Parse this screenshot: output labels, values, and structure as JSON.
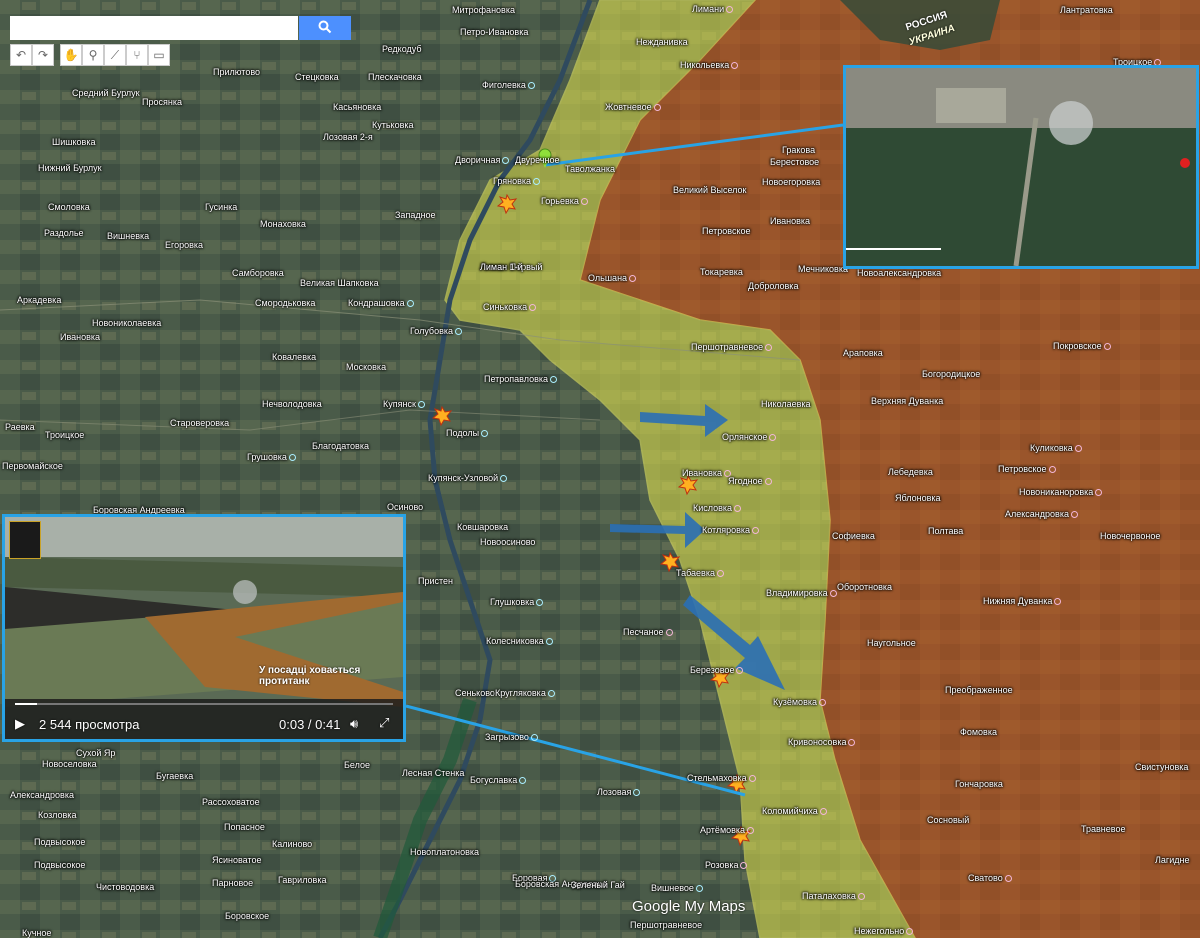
{
  "search": {
    "placeholder": "",
    "value": ""
  },
  "toolbar": {
    "undo_icon": "undo-icon",
    "redo_icon": "redo-icon",
    "pan_icon": "hand-icon",
    "marker_icon": "marker-icon",
    "line_icon": "line-icon",
    "route_icon": "route-icon",
    "ruler_icon": "ruler-icon"
  },
  "border_labels": {
    "russia": "РОССИЯ",
    "ukraine": "УКРАИНА"
  },
  "video_left": {
    "caption": "У посадці ховається протитанк",
    "views": "2 544 просмотра",
    "time": "0:03 / 0:41"
  },
  "watermark": "Google My Maps",
  "colors": {
    "ukraine_zone": "#e6e64d",
    "russia_zone": "#c4622a",
    "accent": "#29a3e6",
    "arrow": "#2a6fb5"
  },
  "places": [
    {
      "name": "Митрофановка",
      "dot": "none"
    },
    {
      "name": "Петро-Ивановка",
      "dot": "none"
    },
    {
      "name": "Редкодуб",
      "dot": "none"
    },
    {
      "name": "Прилютово",
      "dot": "none"
    },
    {
      "name": "Стецковка",
      "dot": "none"
    },
    {
      "name": "Плескачовка",
      "dot": "none"
    },
    {
      "name": "Фиголевка",
      "dot": "blue"
    },
    {
      "name": "Средний Бурлук",
      "dot": "none"
    },
    {
      "name": "Просянка",
      "dot": "none"
    },
    {
      "name": "Касьяновка",
      "dot": "none"
    },
    {
      "name": "Кутьковка",
      "dot": "none"
    },
    {
      "name": "Лозовая 2-я",
      "dot": "none"
    },
    {
      "name": "Шишковка",
      "dot": "none"
    },
    {
      "name": "Нижний Бурлук",
      "dot": "none"
    },
    {
      "name": "Дворичная",
      "dot": "blue"
    },
    {
      "name": "Двуречное",
      "dot": "none"
    },
    {
      "name": "Гряновка",
      "dot": "blue"
    },
    {
      "name": "Таволжанка",
      "dot": "none"
    },
    {
      "name": "Смоловка",
      "dot": "none"
    },
    {
      "name": "Гусинка",
      "dot": "none"
    },
    {
      "name": "Западное",
      "dot": "none"
    },
    {
      "name": "Раздолье",
      "dot": "none"
    },
    {
      "name": "Вишневка",
      "dot": "none"
    },
    {
      "name": "Монаховка",
      "dot": "none"
    },
    {
      "name": "Егоровка",
      "dot": "none"
    },
    {
      "name": "Самборовка",
      "dot": "none"
    },
    {
      "name": "Великая Шапковка",
      "dot": "none"
    },
    {
      "name": "Аркадевка",
      "dot": "none"
    },
    {
      "name": "Смородьковка",
      "dot": "none"
    },
    {
      "name": "Кондрашовка",
      "dot": "blue"
    },
    {
      "name": "Новониколаевка",
      "dot": "none"
    },
    {
      "name": "Ивановка",
      "dot": "none"
    },
    {
      "name": "Голубовка",
      "dot": "blue"
    },
    {
      "name": "Ковалевка",
      "dot": "none"
    },
    {
      "name": "Московка",
      "dot": "none"
    },
    {
      "name": "Нечволодовка",
      "dot": "none"
    },
    {
      "name": "Петропавловка",
      "dot": "blue"
    },
    {
      "name": "Купянск",
      "dot": "blue"
    },
    {
      "name": "Раевка",
      "dot": "none"
    },
    {
      "name": "Староверовка",
      "dot": "none"
    },
    {
      "name": "Троицкое",
      "dot": "none"
    },
    {
      "name": "Подолы",
      "dot": "blue"
    },
    {
      "name": "Благодатовка",
      "dot": "none"
    },
    {
      "name": "Грушовка",
      "dot": "blue"
    },
    {
      "name": "Первомайское",
      "dot": "none"
    },
    {
      "name": "Купянск-Узловой",
      "dot": "blue"
    },
    {
      "name": "Боровская Андреевка",
      "dot": "none"
    },
    {
      "name": "Осиново",
      "dot": "none"
    },
    {
      "name": "Ковшаровка",
      "dot": "none"
    },
    {
      "name": "Новоосиново",
      "dot": "none"
    },
    {
      "name": "Пристен",
      "dot": "none"
    },
    {
      "name": "Глушковка",
      "dot": "blue"
    },
    {
      "name": "Колесниковка",
      "dot": "blue"
    },
    {
      "name": "Сеньково",
      "dot": "none"
    },
    {
      "name": "Кругляковка",
      "dot": "blue"
    },
    {
      "name": "Загрызово",
      "dot": "blue"
    },
    {
      "name": "Сухой Яр",
      "dot": "none"
    },
    {
      "name": "Новоселовка",
      "dot": "none"
    },
    {
      "name": "Бугаевка",
      "dot": "none"
    },
    {
      "name": "Белое",
      "dot": "none"
    },
    {
      "name": "Лесная Стенка",
      "dot": "none"
    },
    {
      "name": "Богуславка",
      "dot": "blue"
    },
    {
      "name": "Александровка",
      "dot": "none"
    },
    {
      "name": "Рассоховатое",
      "dot": "none"
    },
    {
      "name": "Козловка",
      "dot": "none"
    },
    {
      "name": "Попасное",
      "dot": "none"
    },
    {
      "name": "Подвысокое",
      "dot": "none"
    },
    {
      "name": "Калиново",
      "dot": "none"
    },
    {
      "name": "Ясиноватое",
      "dot": "none"
    },
    {
      "name": "Новоплатоновка",
      "dot": "none"
    },
    {
      "name": "Подвысокое",
      "dot": "none"
    },
    {
      "name": "Парновое",
      "dot": "none"
    },
    {
      "name": "Гавриловка",
      "dot": "none"
    },
    {
      "name": "Чистоводовка",
      "dot": "none"
    },
    {
      "name": "Боровское",
      "dot": "none"
    },
    {
      "name": "Кучное",
      "dot": "none"
    },
    {
      "name": "Боровая",
      "dot": "blue"
    },
    {
      "name": "Лозовая",
      "dot": "blue"
    },
    {
      "name": "Боровская Андреевка",
      "dot": "none"
    },
    {
      "name": "Зеленый Гай",
      "dot": "none"
    },
    {
      "name": "Вишневое",
      "dot": "blue"
    },
    {
      "name": "Першотравневое",
      "dot": "none"
    },
    {
      "name": "Лиман Первый",
      "dot": "none"
    },
    {
      "name": "Нежданивка",
      "dot": "none"
    },
    {
      "name": "Никольевка",
      "dot": "pink"
    },
    {
      "name": "Жовтневое",
      "dot": "pink"
    },
    {
      "name": "Горьевка",
      "dot": "pink"
    },
    {
      "name": "Лиман 1-й",
      "dot": "none"
    },
    {
      "name": "Синьковка",
      "dot": "pink"
    },
    {
      "name": "Ольшана",
      "dot": "pink"
    },
    {
      "name": "Першотравневое",
      "dot": "pink"
    },
    {
      "name": "Николаевка",
      "dot": "none"
    },
    {
      "name": "Орлянское",
      "dot": "pink"
    },
    {
      "name": "Ивановка",
      "dot": "pink"
    },
    {
      "name": "Ягодное",
      "dot": "pink"
    },
    {
      "name": "Кисловка",
      "dot": "pink"
    },
    {
      "name": "Котляровка",
      "dot": "pink"
    },
    {
      "name": "Табаевка",
      "dot": "pink"
    },
    {
      "name": "Владимировка",
      "dot": "pink"
    },
    {
      "name": "Песчаное",
      "dot": "pink"
    },
    {
      "name": "Березовое",
      "dot": "pink"
    },
    {
      "name": "Кузёмовка",
      "dot": "pink"
    },
    {
      "name": "Кривоносовка",
      "dot": "pink"
    },
    {
      "name": "Стельмаховка",
      "dot": "pink"
    },
    {
      "name": "Коломийчиха",
      "dot": "pink"
    },
    {
      "name": "Артёмовка",
      "dot": "pink"
    },
    {
      "name": "Розовка",
      "dot": "pink"
    },
    {
      "name": "Паталаховка",
      "dot": "pink"
    },
    {
      "name": "Нежегольно",
      "dot": "pink"
    },
    {
      "name": "Лимани",
      "dot": "pink"
    },
    {
      "name": "Лантратовка",
      "dot": "none"
    },
    {
      "name": "Гракова",
      "dot": "none"
    },
    {
      "name": "Берестовое",
      "dot": "none"
    },
    {
      "name": "Великий Выселок",
      "dot": "none"
    },
    {
      "name": "Новоегоровка",
      "dot": "none"
    },
    {
      "name": "Ивановка",
      "dot": "none"
    },
    {
      "name": "Петровское",
      "dot": "none"
    },
    {
      "name": "Токаревка",
      "dot": "none"
    },
    {
      "name": "Мечниковка",
      "dot": "none"
    },
    {
      "name": "Доброловка",
      "dot": "none"
    },
    {
      "name": "Новоалександровка",
      "dot": "none"
    },
    {
      "name": "Араповка",
      "dot": "none"
    },
    {
      "name": "Покровское",
      "dot": "pink"
    },
    {
      "name": "Богородицкое",
      "dot": "none"
    },
    {
      "name": "Верхняя Дуванка",
      "dot": "none"
    },
    {
      "name": "Куликовка",
      "dot": "pink"
    },
    {
      "name": "Лебедевка",
      "dot": "none"
    },
    {
      "name": "Петровское",
      "dot": "pink"
    },
    {
      "name": "Яблоновка",
      "dot": "none"
    },
    {
      "name": "Новониканоровка",
      "dot": "pink"
    },
    {
      "name": "Александровка",
      "dot": "pink"
    },
    {
      "name": "Софиевка",
      "dot": "none"
    },
    {
      "name": "Полтава",
      "dot": "none"
    },
    {
      "name": "Новочервоное",
      "dot": "none"
    },
    {
      "name": "Оборотновка",
      "dot": "none"
    },
    {
      "name": "Нижняя Дуванка",
      "dot": "pink"
    },
    {
      "name": "Наугольное",
      "dot": "none"
    },
    {
      "name": "Преображенное",
      "dot": "none"
    },
    {
      "name": "Фомовка",
      "dot": "none"
    },
    {
      "name": "Гончаровка",
      "dot": "none"
    },
    {
      "name": "Свистуновка",
      "dot": "none"
    },
    {
      "name": "Сосновый",
      "dot": "none"
    },
    {
      "name": "Травневое",
      "dot": "none"
    },
    {
      "name": "Сватово",
      "dot": "pink"
    },
    {
      "name": "Лагидне",
      "dot": "none"
    },
    {
      "name": "Троицкое",
      "dot": "pink"
    }
  ]
}
